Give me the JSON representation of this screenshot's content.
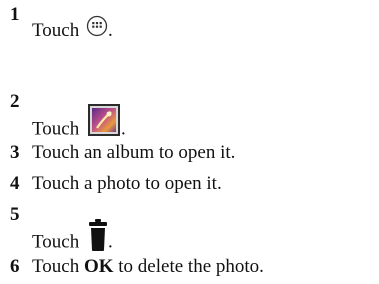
{
  "steps": [
    {
      "number": "1",
      "before": "Touch",
      "icon": "apps-grid-icon",
      "after": "."
    },
    {
      "number": "2",
      "before": "Touch",
      "icon": "gallery-icon",
      "after": "."
    },
    {
      "number": "3",
      "text": "Touch an album to open it."
    },
    {
      "number": "4",
      "text": "Touch a photo to open it."
    },
    {
      "number": "5",
      "before": "Touch",
      "icon": "trash-icon",
      "after": "."
    },
    {
      "number": "6",
      "before": "Touch",
      "bold": "OK",
      "after": "to delete the photo."
    }
  ]
}
